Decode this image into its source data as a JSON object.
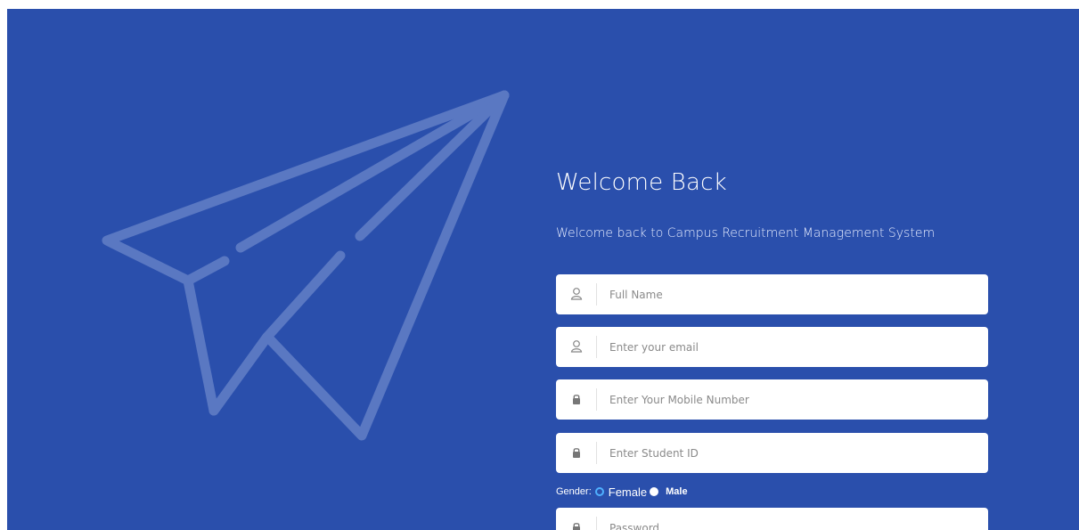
{
  "login": {
    "title": "Welcome Back",
    "subtitle": "Welcome back to Campus Recruitment Management System"
  },
  "form": {
    "full_name": {
      "placeholder": "Full Name",
      "value": "",
      "icon": "user-icon"
    },
    "email": {
      "placeholder": "Enter your email",
      "value": "",
      "icon": "user-icon"
    },
    "mobile": {
      "placeholder": "Enter Your Mobile Number",
      "value": "",
      "icon": "lock-icon"
    },
    "student_id": {
      "placeholder": "Enter Student ID",
      "value": "",
      "icon": "lock-icon"
    },
    "gender": {
      "label": "Gender:",
      "options": [
        "Female",
        "Male"
      ],
      "selected": "Female"
    },
    "password": {
      "placeholder": "Password",
      "value": "",
      "icon": "lock-icon"
    }
  },
  "colors": {
    "background": "#2a4fac",
    "plane": "#5a78c2",
    "field_bg": "#ffffff",
    "radio_accent": "#4fb0ff"
  }
}
